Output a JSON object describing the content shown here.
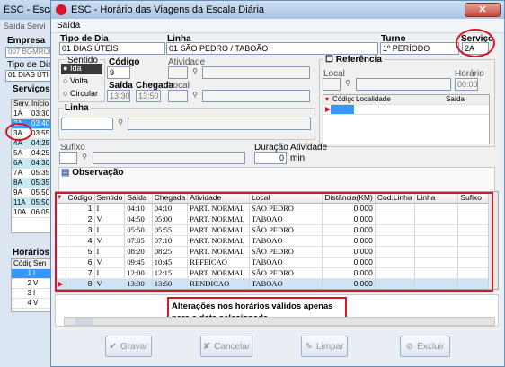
{
  "bg_window": {
    "title": "ESC - Esca",
    "menu": "Saída   Servi",
    "empresa_label": "Empresa",
    "empresa_value": "007 BGMROD",
    "tipo_dia_label": "Tipo de Dia",
    "tipo_dia_value": "01 DIAS ÚTI",
    "servicos_label": "Serviços",
    "servicos_cols": [
      "Serv.",
      "Início"
    ],
    "servicos_rows": [
      [
        "1A",
        "03:30"
      ],
      [
        "2A",
        "03:40"
      ],
      [
        "3A",
        "03:55"
      ],
      [
        "4A",
        "04:25"
      ],
      [
        "5A",
        "04:25"
      ],
      [
        "6A",
        "04:30"
      ],
      [
        "7A",
        "05:35"
      ],
      [
        "8A",
        "05:35"
      ],
      [
        "9A",
        "05:50"
      ],
      [
        "11A",
        "05:50"
      ],
      [
        "10A",
        "06:05"
      ]
    ],
    "horarios_label": "Horários",
    "horarios_cols": [
      "Código",
      "Sen"
    ],
    "horarios_rows": [
      [
        "1",
        "I"
      ],
      [
        "2",
        "V"
      ],
      [
        "3",
        "I"
      ],
      [
        "4",
        "V"
      ]
    ]
  },
  "main": {
    "title": "ESC - Horário das Viagens da Escala Diária",
    "close": "✕",
    "menu": "Saída",
    "tipo_dia_label": "Tipo de Dia",
    "tipo_dia_value": "01 DIAS ÚTEIS",
    "linha_label": "Linha",
    "linha_value": "01 SÃO PEDRO / TABOÃO",
    "turno_label": "Turno",
    "turno_value": "1º PERÍODO",
    "servico_label": "Serviço",
    "servico_value": "2A",
    "sentido_label": "Sentido",
    "sentido_options": [
      "Ida",
      "Volta",
      "Circular"
    ],
    "codigo_label": "Código",
    "codigo_value": "9",
    "atividade_label": "Atividade",
    "saida_label": "Saída",
    "saida_value": "13:30",
    "chegada_label": "Chegada",
    "chegada_value": "13:50",
    "local_label": "Local",
    "referencia_label": "Referência",
    "ref_local_label": "Local",
    "ref_horario_label": "Horário",
    "ref_horario_value": "00:00",
    "ref_cols": [
      "Código",
      "Localidade",
      "Saída"
    ],
    "linha2_label": "Linha",
    "sufixo_label": "Sufixo",
    "duracao_label": "Duração Atividade",
    "duracao_value": "0",
    "duracao_unit": "min",
    "observacao_label": "Observação",
    "grid_cols": [
      "Código",
      "Sentido",
      "Saída",
      "Chegada",
      "Atividade",
      "Local",
      "Distância(KM)",
      "Cod.Linha",
      "Linha",
      "Sufixo"
    ],
    "grid_rows": [
      [
        "1",
        "I",
        "04:10",
        "04:10",
        "PART. NORMAL",
        "SÃO PEDRO",
        "0,000"
      ],
      [
        "2",
        "V",
        "04:50",
        "05:00",
        "PART. NORMAL",
        "TABOAO",
        "0,000"
      ],
      [
        "3",
        "I",
        "05:50",
        "05:55",
        "PART. NORMAL",
        "SÃO PEDRO",
        "0,000"
      ],
      [
        "4",
        "V",
        "07:05",
        "07:10",
        "PART. NORMAL",
        "TABOAO",
        "0,000"
      ],
      [
        "5",
        "I",
        "08:20",
        "08:25",
        "PART. NORMAL",
        "SÃO PEDRO",
        "0,000"
      ],
      [
        "6",
        "V",
        "09:45",
        "10:45",
        "REFEICAO",
        "TABOAO",
        "0,000"
      ],
      [
        "7",
        "I",
        "12:00",
        "12:15",
        "PART. NORMAL",
        "SÃO PEDRO",
        "0,000"
      ],
      [
        "8",
        "V",
        "13:30",
        "13:50",
        "RENDICAO",
        "TABOAO",
        "0,000"
      ]
    ],
    "note": "Alterações nos horários válidos apenas para a data selecionada.",
    "buttons": [
      "Gravar",
      "Cancelar",
      "Limpar",
      "Excluir"
    ]
  },
  "colors": {
    "highlight": "#d4182a",
    "selection": "#3399ff"
  }
}
